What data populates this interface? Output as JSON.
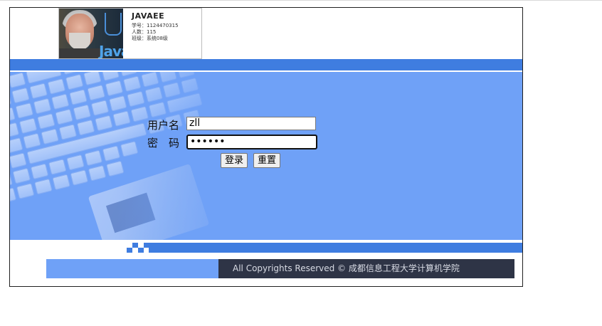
{
  "banner": {
    "name": "JAVAEE",
    "line1": "学号：1124470315",
    "line2": "人数：115",
    "line3": "班级：系统08级",
    "java_text": "Java"
  },
  "login": {
    "username_label": "用户名",
    "password_label": "密　码",
    "username_value": "zll",
    "password_value": "••••••",
    "login_button": "登录",
    "reset_button": "重置"
  },
  "footer": {
    "copyright": "All Copyrights Reserved © 成都信息工程大学计算机学院"
  },
  "colors": {
    "main_blue": "#6fa1f7",
    "bar_blue": "#3f7de0",
    "footer_dark": "#2e3446"
  },
  "icons": [
    "java-logo-icon",
    "avatar-photo",
    "keyboard-graphic"
  ]
}
